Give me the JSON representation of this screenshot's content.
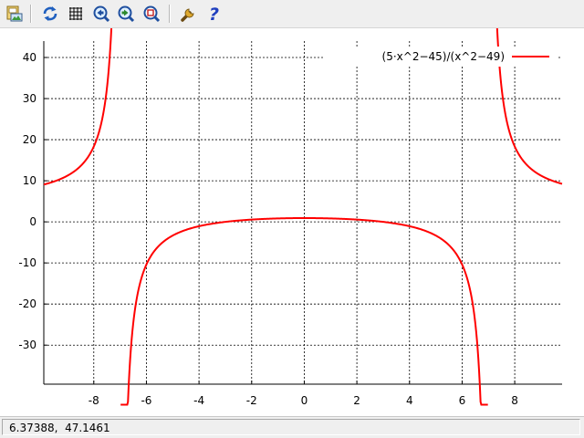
{
  "toolbar": {
    "buttons": [
      {
        "icon": "export-image-icon"
      },
      {
        "icon": "replot-icon"
      },
      {
        "icon": "grid-icon"
      },
      {
        "icon": "previous-zoom-icon"
      },
      {
        "icon": "next-zoom-icon"
      },
      {
        "icon": "autoscale-icon"
      },
      {
        "icon": "settings-icon"
      },
      {
        "icon": "help-icon"
      }
    ]
  },
  "status": {
    "coordinates": "6.37388,  47.1461"
  },
  "colors": {
    "curve": "#ff0000",
    "grid": "#000000",
    "toolbar_bg": "#efefef"
  },
  "chart_data": {
    "type": "line",
    "series": [
      {
        "name": "(5·x^2−45)/(x^2−49)",
        "formula": "(5*x^2-45)/(x^2-49)"
      }
    ],
    "xlim": [
      -9.9,
      9.8
    ],
    "ylim": [
      -39.5,
      44
    ],
    "xticks": [
      -8,
      -6,
      -4,
      -2,
      0,
      2,
      4,
      6,
      8
    ],
    "xtick_labels": [
      "-8",
      "-6",
      "-4",
      "-2",
      "0",
      "2",
      "4",
      "6",
      "8"
    ],
    "yticks": [
      -30,
      -20,
      -10,
      0,
      10,
      20,
      30,
      40
    ],
    "ytick_labels": [
      "-30",
      "-20",
      "-10",
      "0",
      "10",
      "20",
      "30",
      "40"
    ],
    "grid": true,
    "legend_position": "top-right",
    "title": "",
    "xlabel": "",
    "ylabel": ""
  }
}
